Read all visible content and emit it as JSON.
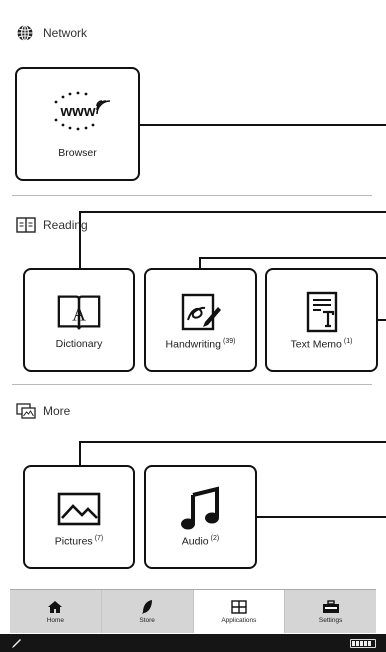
{
  "sections": {
    "network": {
      "title": "Network",
      "icon": "globe-icon"
    },
    "reading": {
      "title": "Reading",
      "icon": "book-icon"
    },
    "more": {
      "title": "More",
      "icon": "images-icon"
    }
  },
  "apps": {
    "browser": {
      "label": "Browser",
      "icon": "www-icon"
    },
    "dictionary": {
      "label": "Dictionary",
      "icon": "dictionary-book-icon"
    },
    "handwriting": {
      "label": "Handwriting",
      "count": "(39)",
      "icon": "handwriting-pen-icon"
    },
    "text_memo": {
      "label": "Text Memo",
      "count": "(1)",
      "icon": "text-memo-icon"
    },
    "pictures": {
      "label": "Pictures",
      "count": "(7)",
      "icon": "picture-icon"
    },
    "audio": {
      "label": "Audio",
      "count": "(2)",
      "icon": "music-note-icon"
    }
  },
  "tabs": [
    {
      "label": "Home",
      "icon": "home-icon",
      "active": false
    },
    {
      "label": "Store",
      "icon": "feather-icon",
      "active": false
    },
    {
      "label": "Applications",
      "icon": "grid-icon",
      "active": true
    },
    {
      "label": "Settings",
      "icon": "toolbox-icon",
      "active": false
    }
  ],
  "status": {
    "left_icon": "stylus-icon",
    "battery_icon": "battery-icon"
  },
  "colors": {
    "tile_border": "#111111",
    "tab_bar_bg": "#d5d5d5",
    "status_bar_bg": "#151515"
  }
}
